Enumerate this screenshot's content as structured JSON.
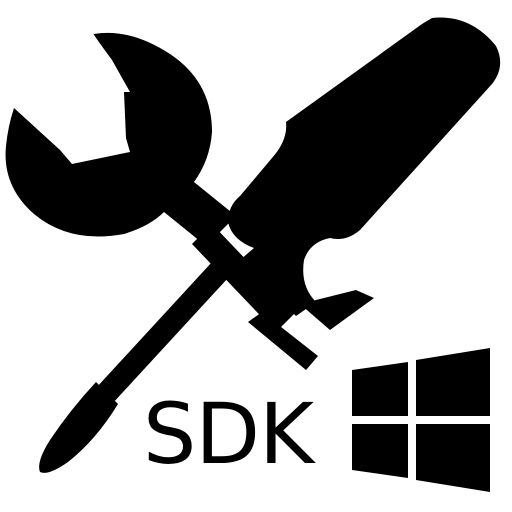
{
  "icon": {
    "wrench": "wrench-icon",
    "screwdriver": "screwdriver-icon",
    "windows_logo": "windows-logo-icon"
  },
  "label": {
    "text": "SDK"
  },
  "colors": {
    "foreground": "#000000",
    "background": "#ffffff"
  }
}
